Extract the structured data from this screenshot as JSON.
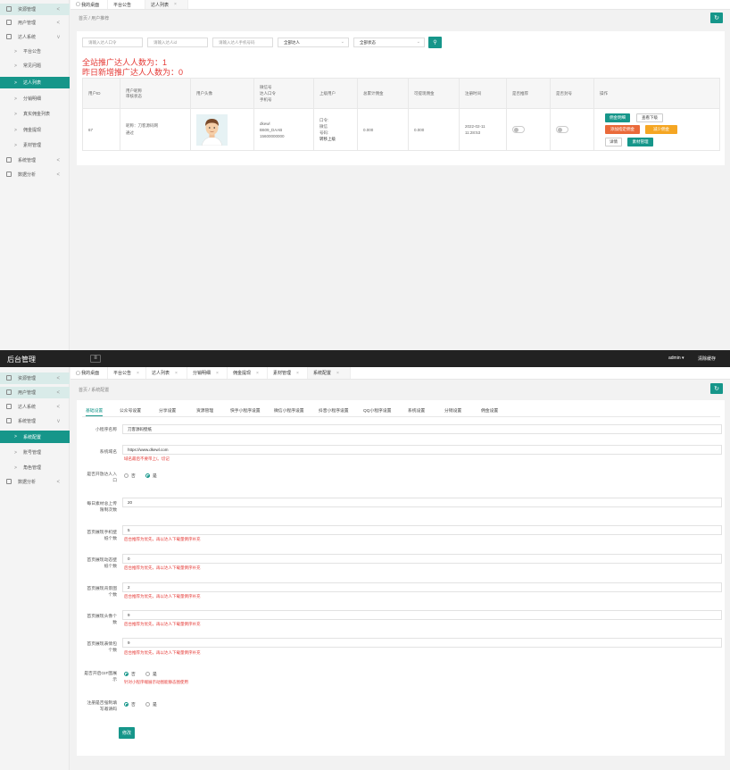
{
  "sidebar1": {
    "items": [
      {
        "label": "资源管理",
        "chevron": "<"
      },
      {
        "label": "用户管理",
        "chevron": "<"
      },
      {
        "label": "达人系统",
        "chevron": "v"
      },
      {
        "label": "平台公告"
      },
      {
        "label": "常见问题"
      },
      {
        "label": "达人列表"
      },
      {
        "label": "分销明细"
      },
      {
        "label": "真实佣金列表"
      },
      {
        "label": "佣金提现"
      },
      {
        "label": "素材管理"
      },
      {
        "label": "系统管理",
        "chevron": "<"
      },
      {
        "label": "数据分析",
        "chevron": "<"
      }
    ]
  },
  "tabs1": [
    {
      "label": "我的桌面"
    },
    {
      "label": "平台公告"
    },
    {
      "label": "达人列表"
    }
  ],
  "crumb1": {
    "home": "首页",
    "sep": "/",
    "current": "用户推荐"
  },
  "filters": {
    "code_ph": "请输入达人口令",
    "id_ph": "请输入达人id",
    "phone_ph": "请输入达人手机号码",
    "select1": "全部达人",
    "select2": "全部状态"
  },
  "stats": {
    "line1": "全站推广达人人数为：1",
    "line2": "昨日新增推广达人人数为：0"
  },
  "table": {
    "headers": [
      "用户ID",
      "用户昵称\n审核状态",
      "用户头像",
      "微信号\n达人口令\n手机号",
      "上级用户",
      "总累计佣金",
      "可提现佣金",
      "注册时间",
      "是否推荐",
      "是否封号",
      "操作"
    ],
    "row": {
      "id": "67",
      "nick": "昵称：刀客源码网",
      "status": "通过",
      "wx": "dkewl",
      "code": "B609_DAAB",
      "phone": "15600000000",
      "parent": [
        "口令:",
        "微信",
        "号码:",
        "转移上级"
      ],
      "total": "0.000",
      "avail": "0.000",
      "reg_date": "2022-02-11",
      "reg_time": "11:28:53",
      "actions": {
        "detail": "佣金明细",
        "sub": "查看下级",
        "add": "添加指定佣金",
        "reduce": "减少佣金",
        "info": "详情",
        "material": "素材管理"
      }
    }
  },
  "topbar": {
    "title": "后台管理",
    "user": "admin",
    "cache": "清除缓存"
  },
  "sidebar2": {
    "items": [
      {
        "label": "资源管理",
        "chevron": "<"
      },
      {
        "label": "用户管理",
        "chevron": "<"
      },
      {
        "label": "达人系统",
        "chevron": "<"
      },
      {
        "label": "系统管理",
        "chevron": "v"
      },
      {
        "label": "系统配置"
      },
      {
        "label": "账号管理"
      },
      {
        "label": "角色管理"
      },
      {
        "label": "数据分析",
        "chevron": "<"
      }
    ]
  },
  "tabs2": [
    {
      "label": "我的桌面"
    },
    {
      "label": "平台公告"
    },
    {
      "label": "达人列表"
    },
    {
      "label": "分销明细"
    },
    {
      "label": "佣金提现"
    },
    {
      "label": "素材管理"
    },
    {
      "label": "系统配置"
    }
  ],
  "crumb2": {
    "home": "首页",
    "sep": "/",
    "current": "系统配置"
  },
  "form_tabs": [
    "基础设置",
    "公众号设置",
    "分享设置",
    "资源管理",
    "快手小程序设置",
    "微信小程序设置",
    "抖音小程序设置",
    "QQ小程序设置",
    "系统设置",
    "分销设置",
    "佣金设置"
  ],
  "form": {
    "name_label": "小程序名称",
    "name_value": "刀客源码壁纸",
    "domain_label": "系统域名",
    "domain_value": "https://www.dkewl.com",
    "domain_hint": "域名最后不要带上/。切记",
    "open_label": "是否开放达人入口",
    "no": "否",
    "yes": "是",
    "limit_label": "每日素材总上传限制次数",
    "limit_value": "20",
    "f1_label": "首页展现手机壁纸个数",
    "f1_value": "5",
    "f1_hint": "后台推荐为优先，再以达人下载量倒序补充",
    "f2_label": "首页展现动态壁纸个数",
    "f2_value": "0",
    "f2_hint": "后台推荐为优先，再以达人下载量倒序补充",
    "f3_label": "首页展现背景图个数",
    "f3_value": "2",
    "f3_hint": "后台推荐为优先，再以达人下载量倒序补充",
    "f4_label": "首页展现头像个数",
    "f4_value": "9",
    "f4_hint": "后台推荐为优先，再以达人下载量倒序补充",
    "f5_label": "首页展现表情包个数",
    "f5_value": "9",
    "f5_hint": "后台推荐为优先，再以达人下载量倒序补充",
    "gif_label": "是否开启GIF图展示",
    "gif_hint": "针对小程序端展示动图能静态图使用",
    "reg_label": "注册是否强制填写邀请码",
    "submit": "修改"
  },
  "colors": {
    "accent": "#16968a",
    "danger": "#e53935",
    "orange": "#f5a623"
  }
}
